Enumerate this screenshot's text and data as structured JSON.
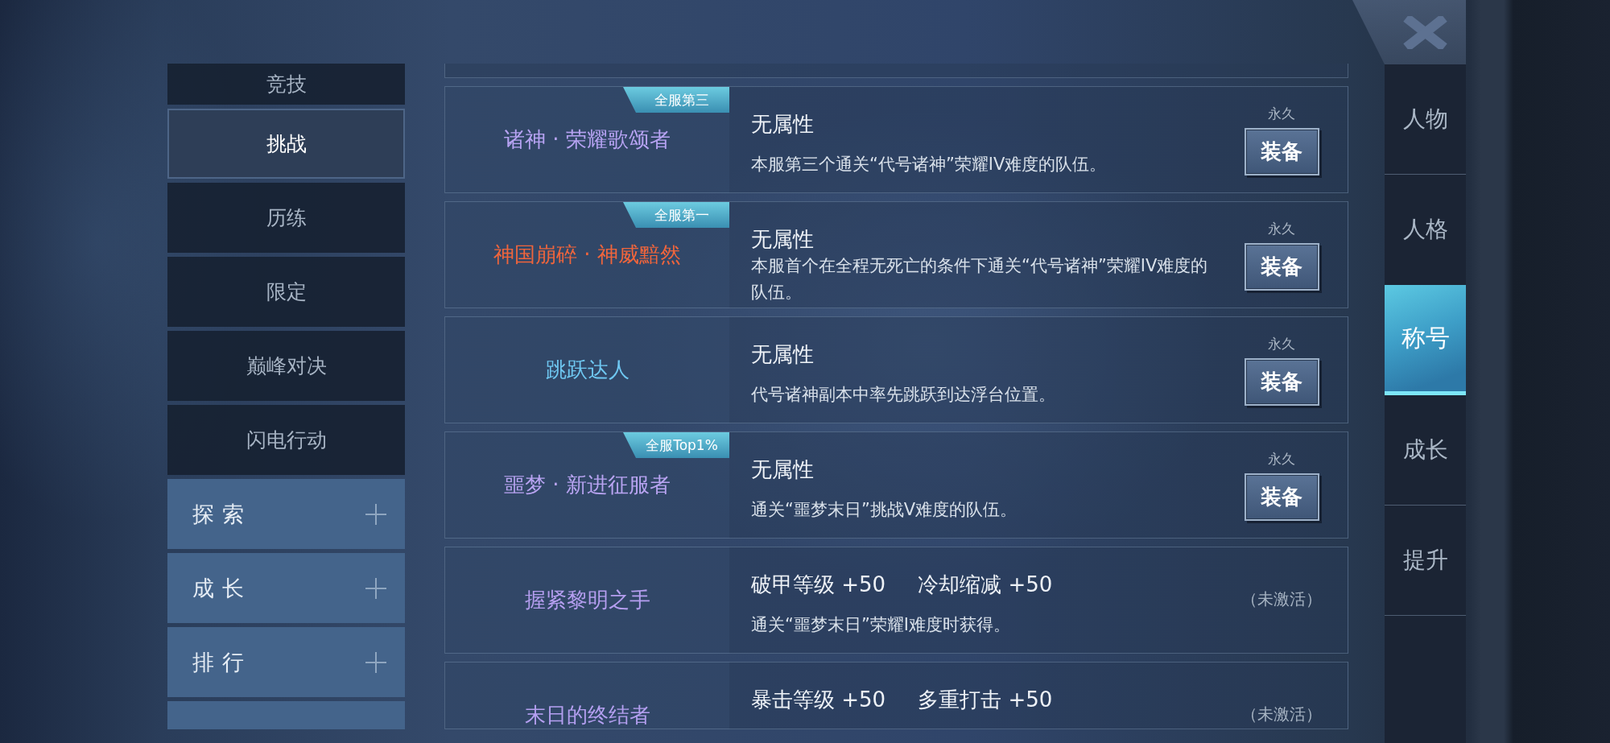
{
  "sidebar": {
    "categories": [
      {
        "label": "竞技",
        "selected": false
      },
      {
        "label": "挑战",
        "selected": true
      },
      {
        "label": "历练",
        "selected": false
      },
      {
        "label": "限定",
        "selected": false
      },
      {
        "label": "巅峰对决",
        "selected": false
      },
      {
        "label": "闪电行动",
        "selected": false
      }
    ],
    "groups": [
      {
        "label": "探索",
        "expandable": true
      },
      {
        "label": "成长",
        "expandable": true
      },
      {
        "label": "排行",
        "expandable": true
      }
    ],
    "more_below": true
  },
  "list": {
    "more_above": true,
    "rows": [
      {
        "kind": "owned",
        "title": "诸神 · 荣耀歌颂者",
        "color": "#b7a3f3",
        "badge": "全服第三",
        "attributes": [
          "无属性"
        ],
        "description": "本服第三个通关“代号诸神”荣耀IV难度的队伍。",
        "duration": "永久",
        "button": "装备"
      },
      {
        "kind": "owned",
        "title": "神国崩碎 · 神威黯然",
        "color": "#f0653c",
        "badge": "全服第一",
        "attributes": [
          "无属性"
        ],
        "description": "本服首个在全程无死亡的条件下通关“代号诸神”荣耀IV难度的队伍。",
        "duration": "永久",
        "button": "装备"
      },
      {
        "kind": "owned",
        "title": "跳跃达人",
        "color": "#6fc8f2",
        "attributes": [
          "无属性"
        ],
        "description": "代号诸神副本中率先跳跃到达浮台位置。",
        "duration": "永久",
        "button": "装备"
      },
      {
        "kind": "owned",
        "title": "噩梦 · 新进征服者",
        "color": "#b9a4f2",
        "badge": "全服Top1%",
        "attributes": [
          "无属性"
        ],
        "description": "通关“噩梦末日”挑战V难度的队伍。",
        "duration": "永久",
        "button": "装备"
      },
      {
        "kind": "locked",
        "title": "握紧黎明之手",
        "color": "#b59ef0",
        "attributes": [
          "破甲等级 +50",
          "冷却缩减 +50"
        ],
        "description": "通关“噩梦末日”荣耀Ⅰ难度时获得。",
        "status": "（未激活）"
      },
      {
        "kind": "locked",
        "title": "末日的终结者",
        "color": "#b49ff0",
        "attributes": [
          "暴击等级 +50",
          "多重打击 +50"
        ],
        "status": "（未激活）"
      }
    ]
  },
  "tabs": [
    {
      "label": "人物",
      "selected": false
    },
    {
      "label": "人格",
      "selected": false
    },
    {
      "label": "称号",
      "selected": true
    },
    {
      "label": "成长",
      "selected": false
    },
    {
      "label": "提升",
      "selected": false
    }
  ]
}
